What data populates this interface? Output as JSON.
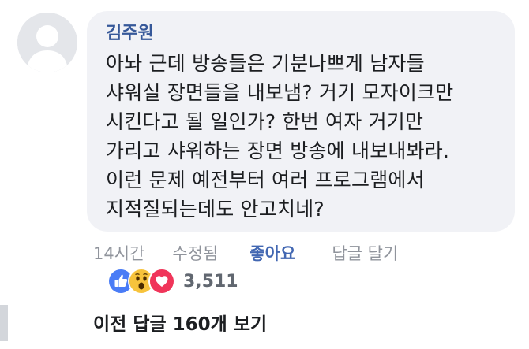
{
  "comment": {
    "author": "김주원",
    "lines": "아놔 근데 방송들은 기분나쁘게 남자들\n샤워실 장면들을 내보냄? 거기 모자이크만\n시킨다고 될 일인가? 한번 여자 거기만\n가리고 샤워하는 장면 방송에 내보내봐라.\n이런 문제 예전부터 여러 프로그램에서\n지적질되는데도 안고치네?",
    "time": "14시간",
    "edited": "수정됨",
    "like_label": "좋아요",
    "reply_label": "답글 달기",
    "reaction_count": "3,511",
    "reactions": [
      "like-icon",
      "wow-icon",
      "love-icon"
    ]
  },
  "replies": {
    "view_previous": "이전 답글 160개 보기"
  },
  "colors": {
    "bubble": "#f1f2f6",
    "author": "#365899",
    "like_active": "#4267b2",
    "meta": "#90949c",
    "like_icon": "#4a7cf6",
    "wow_icon": "#f7c33c",
    "love_icon": "#f0355a"
  }
}
